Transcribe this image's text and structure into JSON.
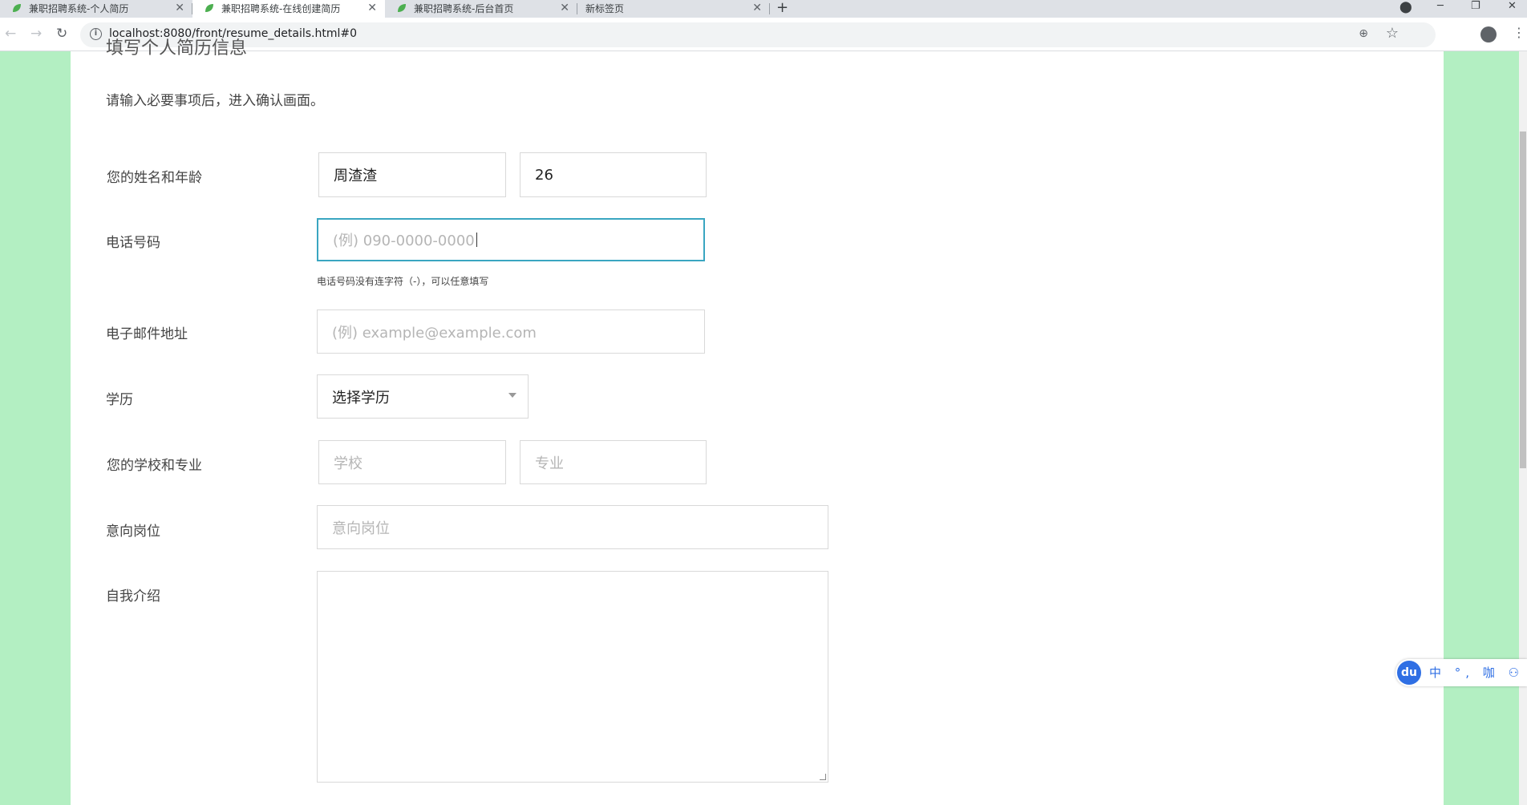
{
  "browser": {
    "tabs": [
      {
        "title": "兼职招聘系统-个人简历",
        "active": false
      },
      {
        "title": "兼职招聘系统-在线创建简历",
        "active": true
      },
      {
        "title": "兼职招聘系统-后台首页",
        "active": false
      },
      {
        "title": "新标签页",
        "active": false
      }
    ],
    "new_tab": "+",
    "url": "localhost:8080/front/resume_details.html#0",
    "colors": {
      "favicon": "#4caf50",
      "page_bg": "#b3efc2",
      "focus": "#3aa6c1"
    }
  },
  "page": {
    "heading_partial": "填写个人简历信息",
    "intro": "请输入必要事项后，进入确认画面。",
    "form": {
      "name_age_label": "您的姓名和年龄",
      "name_value": "周渣渣",
      "age_value": "26",
      "phone_label": "电话号码",
      "phone_placeholder": "(例) 090-0000-0000",
      "phone_hint": "电话号码没有连字符（-），可以任意填写",
      "email_label": "电子邮件地址",
      "email_placeholder": "(例) example@example.com",
      "education_label": "学历",
      "education_selected": "选择学历",
      "school_major_label": "您的学校和专业",
      "school_placeholder": "学校",
      "major_placeholder": "专业",
      "position_label": "意向岗位",
      "position_placeholder": "意向岗位",
      "intro_label": "自我介绍",
      "intro_value": ""
    }
  },
  "ime": {
    "logo": "du",
    "chars": "中 °, 咖 ⚇ ⊞"
  }
}
